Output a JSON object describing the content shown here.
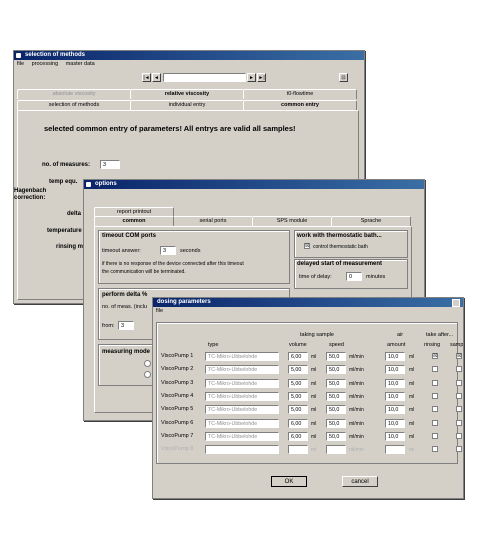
{
  "win1": {
    "title": "selection of methods",
    "menu": [
      "file",
      "processing",
      "master data"
    ],
    "nav": {
      "first": "|◄",
      "prev": "◄",
      "next": "►",
      "last": "►|"
    },
    "tabs_back": [
      "absolute viscosity",
      "relative viscosity",
      "t0-flowtime"
    ],
    "tabs_front": [
      "selection of methods",
      "individual entry",
      "common entry"
    ],
    "heading": "selected common entry of parameters! All entrys are valid all samples!",
    "no_of_measures_label": "no. of measures:",
    "no_of_measures_value": "3",
    "temp_label": "temp equ.",
    "hagenbach_label": "Hagenbach correction:",
    "delta_label": "delta",
    "temperature_label": "temperature",
    "rinsing_label": "rinsing m"
  },
  "win2": {
    "title": "options",
    "tabs_back": [
      "report printout"
    ],
    "tabs_front": [
      "common",
      "serial ports",
      "SPS module",
      "Sprache"
    ],
    "timeout_title": "timeout COM ports",
    "timeout_label": "timeout answer:",
    "timeout_value": "3",
    "timeout_unit": "seconds",
    "timeout_note1": "if there is no response of the device connected after this timeout",
    "timeout_note2": "the communication will be terminated.",
    "bath_title": "work with thermostatic bath...",
    "bath_checkbox": "control thermostatic bath",
    "bath_checked": "☒",
    "delay_title": "delayed start of measurement",
    "delay_label": "time of delay:",
    "delay_value": "0",
    "delay_unit": "minutes",
    "perform_title": "perform delta %",
    "no_meas_label": "no. of meas. (inclu",
    "from_label": "from:",
    "from_value": "3",
    "measuring_mode_label": "measuring mode"
  },
  "win3": {
    "title": "dosing parameters",
    "menu": [
      "file"
    ],
    "group_taking_sample": "taking sample",
    "group_air": "air",
    "group_take_after": "take after...",
    "col_type": "type",
    "col_volume": "volume",
    "col_speed": "speed",
    "col_amount": "amount",
    "col_rinsing": "rinsing",
    "col_sample": "sample",
    "rows": [
      {
        "name": "ViscoPump 1",
        "type": "TC-Mikro-Ubbelohde",
        "volume": "6,00",
        "vol_unit": "ml",
        "speed": "50,0",
        "speed_unit": "ml/min",
        "amount": "10,0",
        "amount_unit": "ml",
        "rinsing": "☒",
        "sample": "☒"
      },
      {
        "name": "ViscoPump 2",
        "type": "TC-Mikro-Ubbelohde",
        "volume": "5,00",
        "vol_unit": "ml",
        "speed": "50,0",
        "speed_unit": "ml/min",
        "amount": "10,0",
        "amount_unit": "ml",
        "rinsing": "",
        "sample": ""
      },
      {
        "name": "ViscoPump 3",
        "type": "TC-Mikro-Ubbelohde",
        "volume": "5,00",
        "vol_unit": "ml",
        "speed": "50,0",
        "speed_unit": "ml/min",
        "amount": "10,0",
        "amount_unit": "ml",
        "rinsing": "",
        "sample": ""
      },
      {
        "name": "ViscoPump 4",
        "type": "TC-Mikro-Ubbelohde",
        "volume": "5,00",
        "vol_unit": "ml",
        "speed": "50,0",
        "speed_unit": "ml/min",
        "amount": "10,0",
        "amount_unit": "ml",
        "rinsing": "",
        "sample": ""
      },
      {
        "name": "ViscoPump 5",
        "type": "TC-Mikro-Ubbelohde",
        "volume": "5,00",
        "vol_unit": "ml",
        "speed": "50,0",
        "speed_unit": "ml/min",
        "amount": "10,0",
        "amount_unit": "ml",
        "rinsing": "",
        "sample": ""
      },
      {
        "name": "ViscoPump 6",
        "type": "TC-Mikro-Ubbelohde",
        "volume": "6,00",
        "vol_unit": "ml",
        "speed": "50,0",
        "speed_unit": "ml/min",
        "amount": "10,0",
        "amount_unit": "ml",
        "rinsing": "",
        "sample": ""
      },
      {
        "name": "ViscoPump 7",
        "type": "TC-Mikro-Ubbelohde",
        "volume": "6,00",
        "vol_unit": "ml",
        "speed": "50,0",
        "speed_unit": "ml/min",
        "amount": "10,0",
        "amount_unit": "ml",
        "rinsing": "",
        "sample": ""
      },
      {
        "name": "ViscoPump 8",
        "type": "",
        "volume": "",
        "vol_unit": "ml",
        "speed": "",
        "speed_unit": "ml/min",
        "amount": "",
        "amount_unit": "ml",
        "rinsing": "",
        "sample": ""
      }
    ],
    "ok_label": "OK",
    "cancel_label": "cancel"
  }
}
